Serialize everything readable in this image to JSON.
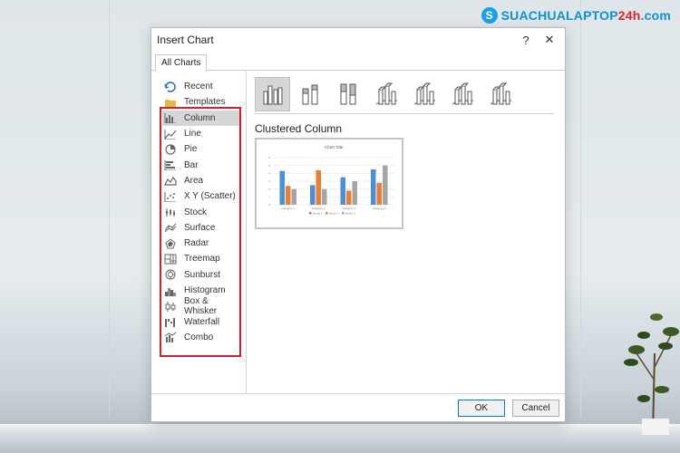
{
  "brand": {
    "logo_text_main": "SUACHUALAPTOP",
    "logo_text_accent": "24h",
    "logo_text_suffix": ".com"
  },
  "dialog": {
    "title": "Insert Chart",
    "help_label": "?",
    "close_label": "✕",
    "tab_all_charts": "All Charts",
    "selected_variant_name": "Clustered Column",
    "ok_label": "OK",
    "cancel_label": "Cancel"
  },
  "chart_types": [
    {
      "label": "Recent",
      "icon": "recent-icon"
    },
    {
      "label": "Templates",
      "icon": "folder-icon"
    },
    {
      "label": "Column",
      "icon": "column-chart-icon"
    },
    {
      "label": "Line",
      "icon": "line-chart-icon"
    },
    {
      "label": "Pie",
      "icon": "pie-chart-icon"
    },
    {
      "label": "Bar",
      "icon": "bar-chart-icon"
    },
    {
      "label": "Area",
      "icon": "area-chart-icon"
    },
    {
      "label": "X Y (Scatter)",
      "icon": "scatter-chart-icon"
    },
    {
      "label": "Stock",
      "icon": "stock-chart-icon"
    },
    {
      "label": "Surface",
      "icon": "surface-chart-icon"
    },
    {
      "label": "Radar",
      "icon": "radar-chart-icon"
    },
    {
      "label": "Treemap",
      "icon": "treemap-icon"
    },
    {
      "label": "Sunburst",
      "icon": "sunburst-icon"
    },
    {
      "label": "Histogram",
      "icon": "histogram-icon"
    },
    {
      "label": "Box & Whisker",
      "icon": "box-whisker-icon"
    },
    {
      "label": "Waterfall",
      "icon": "waterfall-icon"
    },
    {
      "label": "Combo",
      "icon": "combo-chart-icon"
    }
  ],
  "selected_chart_type": "Column",
  "preview_chart": {
    "title": "Chart Title",
    "categories": [
      "Category 1",
      "Category 2",
      "Category 3",
      "Category 4"
    ],
    "series": [
      {
        "name": "Series 1",
        "values": [
          4.3,
          2.5,
          3.5,
          4.5
        ],
        "color": "#4a90d9"
      },
      {
        "name": "Series 2",
        "values": [
          2.4,
          4.4,
          1.8,
          2.8
        ],
        "color": "#ed7d31"
      },
      {
        "name": "Series 3",
        "values": [
          2.0,
          2.0,
          3.0,
          5.0
        ],
        "color": "#a5a5a5"
      }
    ],
    "ylim": [
      0,
      6
    ]
  },
  "colors": {
    "highlight_red": "#d41f2b",
    "selection_gray": "#d6d6d6",
    "ok_border": "#0078d7"
  }
}
